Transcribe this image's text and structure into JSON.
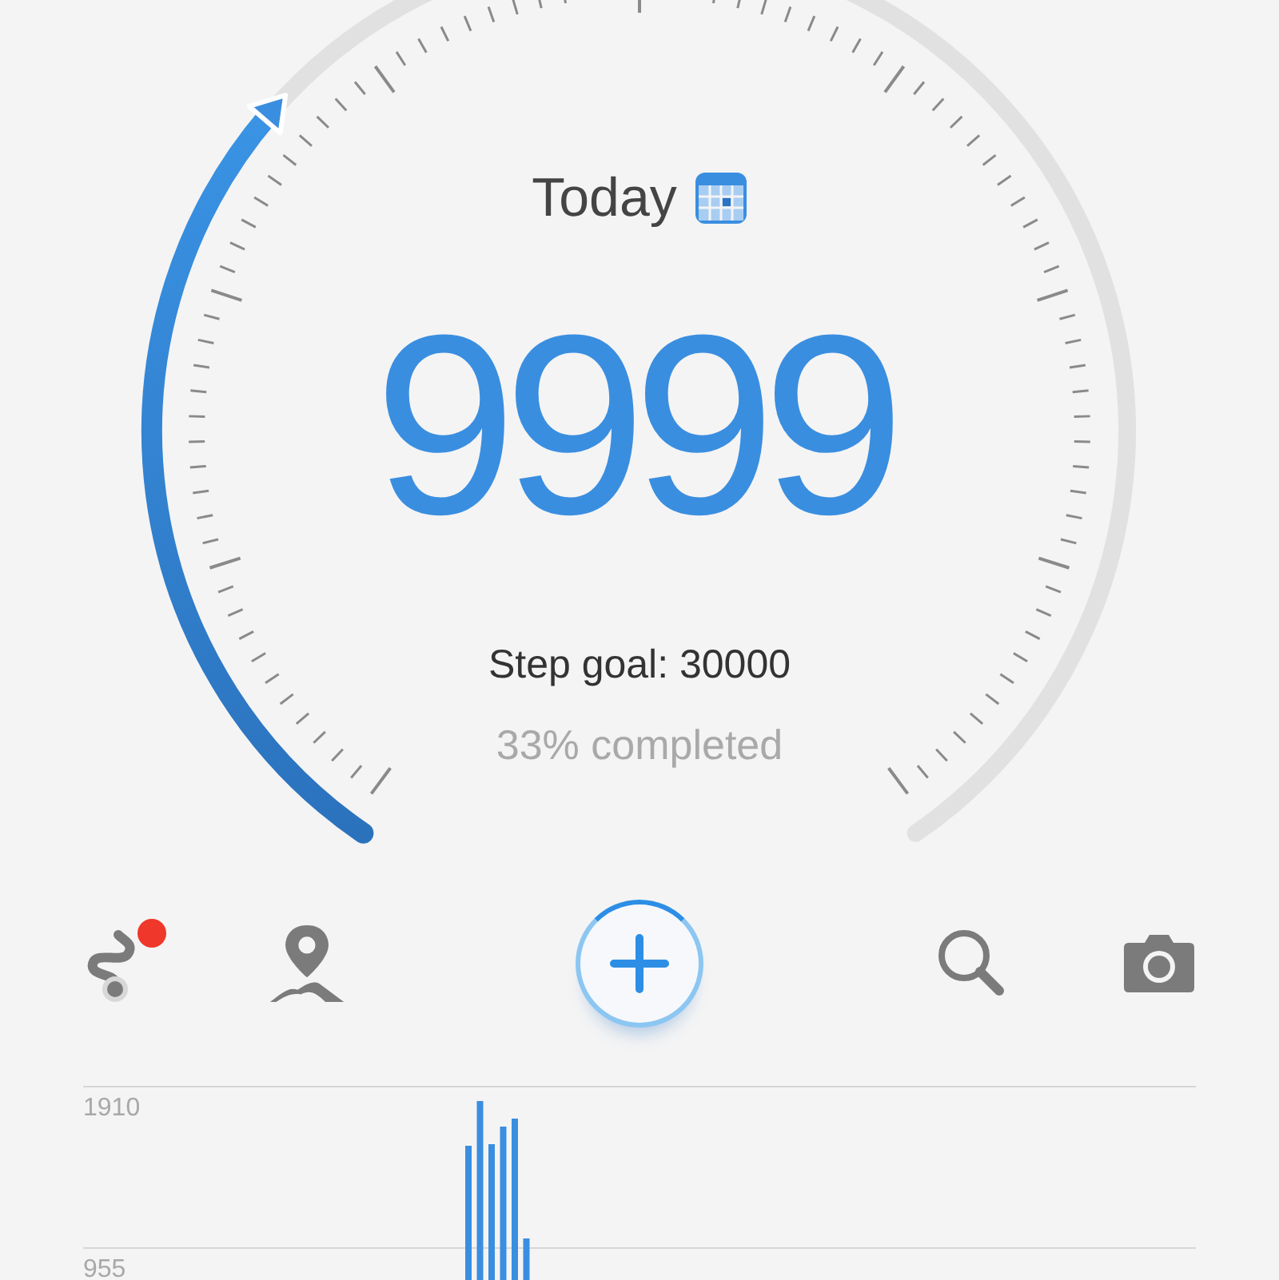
{
  "header": {
    "title": "Today"
  },
  "steps": {
    "count": "9999",
    "goal": "Step goal: 30000",
    "completion": "33% completed"
  },
  "toolbar": [
    {
      "kind": "route",
      "notification": true
    },
    {
      "kind": "map",
      "notification": false
    },
    {
      "kind": "add",
      "notification": false
    },
    {
      "kind": "search",
      "notification": false
    },
    {
      "kind": "camera",
      "notification": false
    }
  ],
  "chart": {
    "grid_labels": [
      "1910",
      "955"
    ]
  }
}
